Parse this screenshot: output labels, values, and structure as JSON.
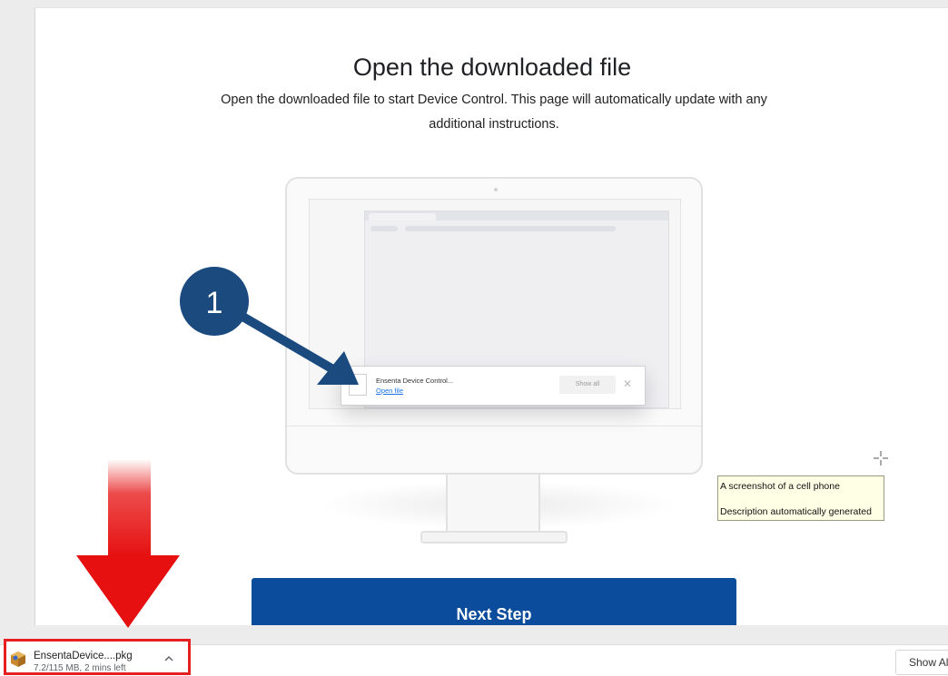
{
  "page": {
    "heading": "Open the downloaded file",
    "instructions": "Open the downloaded file to start Device Control. This page will automatically update with any additional instructions."
  },
  "illustration": {
    "step_number": "1",
    "popup_filename": "Ensenta Device Control...",
    "popup_link": "Open file",
    "popup_show_all": "Show all",
    "step_badge_color": "#1b4a7e"
  },
  "actions": {
    "next_step_label": "Next Step",
    "button_color": "#0b4c9c"
  },
  "tooltip": {
    "line1": "A screenshot of a cell phone",
    "line2": "Description automatically generated"
  },
  "download_shelf": {
    "filename": "EnsentaDevice....pkg",
    "progress": "7.2/115 MB, 2 mins left",
    "show_all_label": "Show All"
  },
  "annotation": {
    "arrow_color": "#e61010",
    "highlight_color": "#e62020"
  }
}
